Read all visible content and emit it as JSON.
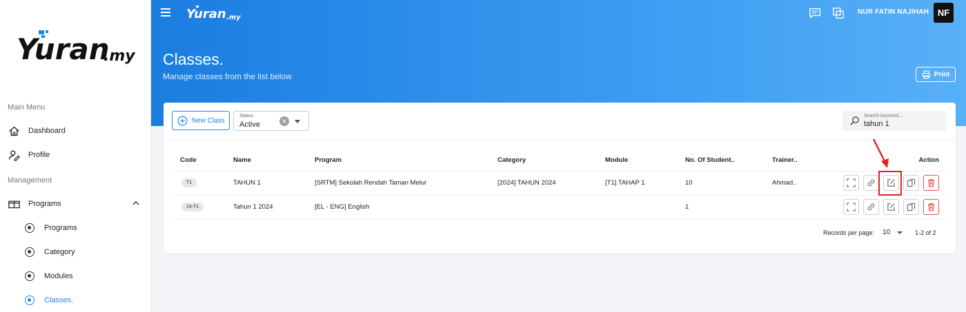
{
  "brand": {
    "name": "Yuran",
    "suffix": ".my",
    "color": "#1e88e5"
  },
  "sidebar": {
    "main_menu_label": "Main Menu",
    "management_label": "Management",
    "items": [
      {
        "label": "Dashboard",
        "icon": "home-icon"
      },
      {
        "label": "Profile",
        "icon": "user-edit-icon"
      },
      {
        "label": "Programs",
        "icon": "book-icon"
      }
    ],
    "sub_items": [
      {
        "label": "Programs"
      },
      {
        "label": "Category"
      },
      {
        "label": "Modules"
      },
      {
        "label": "Classes."
      }
    ]
  },
  "header": {
    "user_name": "NUR FATIN NAJIHAH",
    "avatar_initials": "NF",
    "title": "Classes.",
    "subtitle": "Manage classes from the list below",
    "print_label": "Print"
  },
  "toolbar": {
    "new_class_label": "New Class",
    "status_label": "Status",
    "status_value": "Active",
    "search_placeholder": "Search keyword...",
    "search_value": "tahun 1"
  },
  "table": {
    "headers": [
      "Code",
      "Name",
      "Program",
      "Category",
      "Module",
      "No. Of Student..",
      "Trainer..",
      "Action"
    ],
    "rows": [
      {
        "code": "T1",
        "name": "TAHUN 1",
        "program": "[SRTM] Sekolah Rendah Taman Melur",
        "category": "[2024] TAHUN 2024",
        "module": "[T1] TAHAP 1",
        "students": "10",
        "trainer": "Ahmad.."
      },
      {
        "code": "24-T1",
        "name": "Tahun 1 2024",
        "program": "[EL - ENG] English",
        "category": "",
        "module": "",
        "students": "1",
        "trainer": ""
      }
    ]
  },
  "pagination": {
    "records_per_page_label": "Records per page:",
    "per_page": "10",
    "range": "1-2 of 2"
  }
}
